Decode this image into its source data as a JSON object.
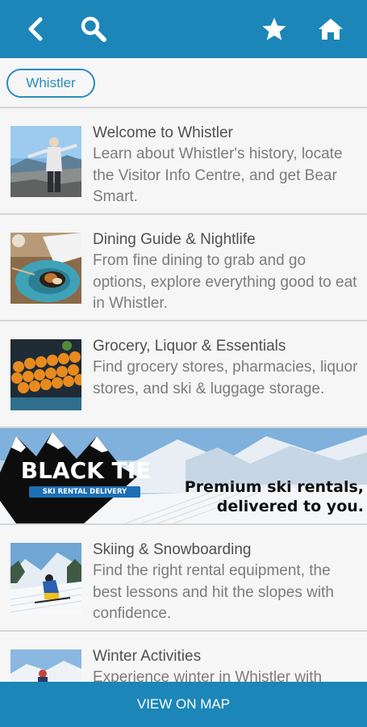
{
  "header": {
    "back_icon": "back-arrow-icon",
    "search_icon": "search-icon",
    "favorite_icon": "star-icon",
    "home_icon": "home-icon"
  },
  "filter": {
    "chip_label": "Whistler"
  },
  "items": [
    {
      "title": "Welcome to Whistler",
      "description": "Learn about Whistler's history, locate the Visitor Info Centre, and get Bear Smart."
    },
    {
      "title": "Dining Guide & Nightlife",
      "description": "From fine dining to grab and go options, explore everything good to eat in Whistler."
    },
    {
      "title": "Grocery, Liquor & Essentials",
      "description": "Find grocery stores, pharmacies, liquor stores, and ski & luggage storage."
    },
    {
      "title": "Skiing & Snowboarding",
      "description": "Find the right rental equipment, the best lessons and hit the slopes with confidence."
    },
    {
      "title": "Winter Activities",
      "description": "Experience winter in Whistler with"
    }
  ],
  "banner": {
    "brand": "BLACK TIE",
    "brand_sub": "SKI RENTAL DELIVERY",
    "tagline_1": "Premium ski rentals,",
    "tagline_2": "delivered to you."
  },
  "footer": {
    "map_button_label": "VIEW ON MAP"
  },
  "colors": {
    "brand_blue": "#1c86b8",
    "chip_blue": "#2a8cc0"
  }
}
